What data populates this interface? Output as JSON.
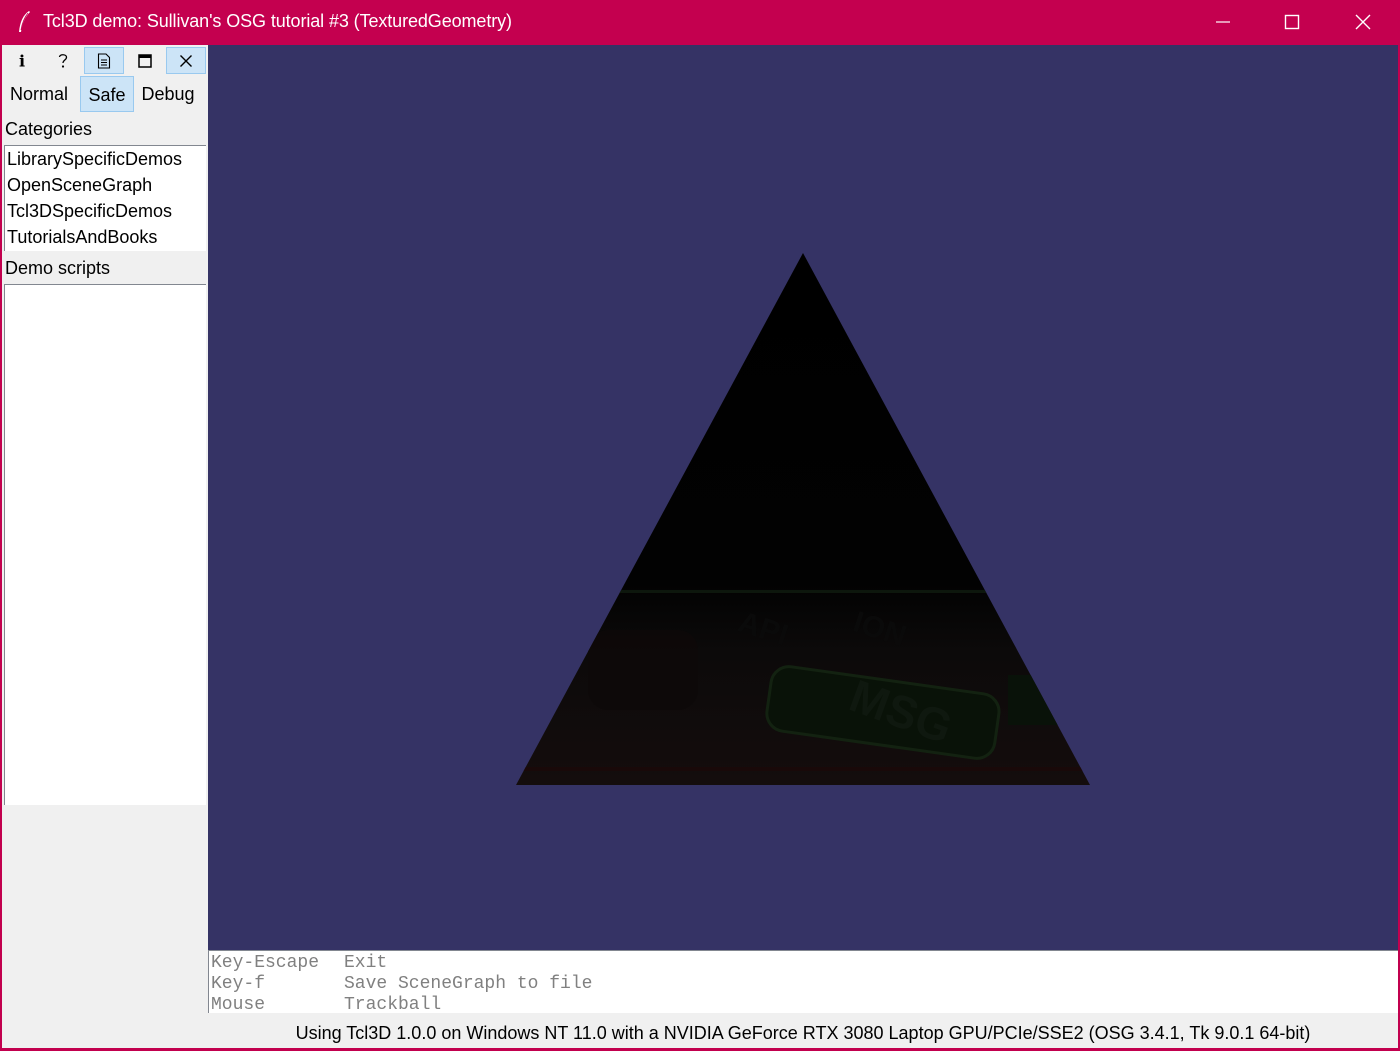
{
  "window": {
    "title": "Tcl3D demo: Sullivan's OSG tutorial #3 (TexturedGeometry)",
    "accent_color": "#c4004f",
    "controls": [
      "minimize-icon",
      "maximize-icon",
      "close-icon"
    ]
  },
  "toolbar": {
    "buttons": [
      {
        "name": "info",
        "icon": "info-icon",
        "glyph": "i"
      },
      {
        "name": "help",
        "icon": "help-icon",
        "glyph": "?"
      },
      {
        "name": "view-source",
        "icon": "document-icon"
      },
      {
        "name": "fullscreen",
        "icon": "window-icon"
      },
      {
        "name": "exit",
        "icon": "close-icon"
      }
    ]
  },
  "modes": {
    "normal": "Normal",
    "safe": "Safe",
    "debug": "Debug",
    "selected": "Safe"
  },
  "categories": {
    "label": "Categories",
    "items": [
      "LibrarySpecificDemos",
      "OpenSceneGraph",
      "Tcl3DSpecificDemos",
      "TutorialsAndBooks"
    ]
  },
  "demo_scripts": {
    "label": "Demo scripts",
    "items": []
  },
  "scene": {
    "background_color": "#353365",
    "object": "textured triangle",
    "texture_text": [
      "API",
      "ION",
      "MSG"
    ]
  },
  "help": {
    "rows": [
      {
        "key": "Key-Escape",
        "action": "Exit"
      },
      {
        "key": "Key-f",
        "action": "Save SceneGraph to file"
      },
      {
        "key": "Mouse",
        "action": "Trackball"
      }
    ]
  },
  "status": "Using Tcl3D 1.0.0 on Windows NT 11.0 with a NVIDIA GeForce RTX 3080 Laptop GPU/PCIe/SSE2 (OSG 3.4.1, Tk 9.0.1 64-bit)"
}
